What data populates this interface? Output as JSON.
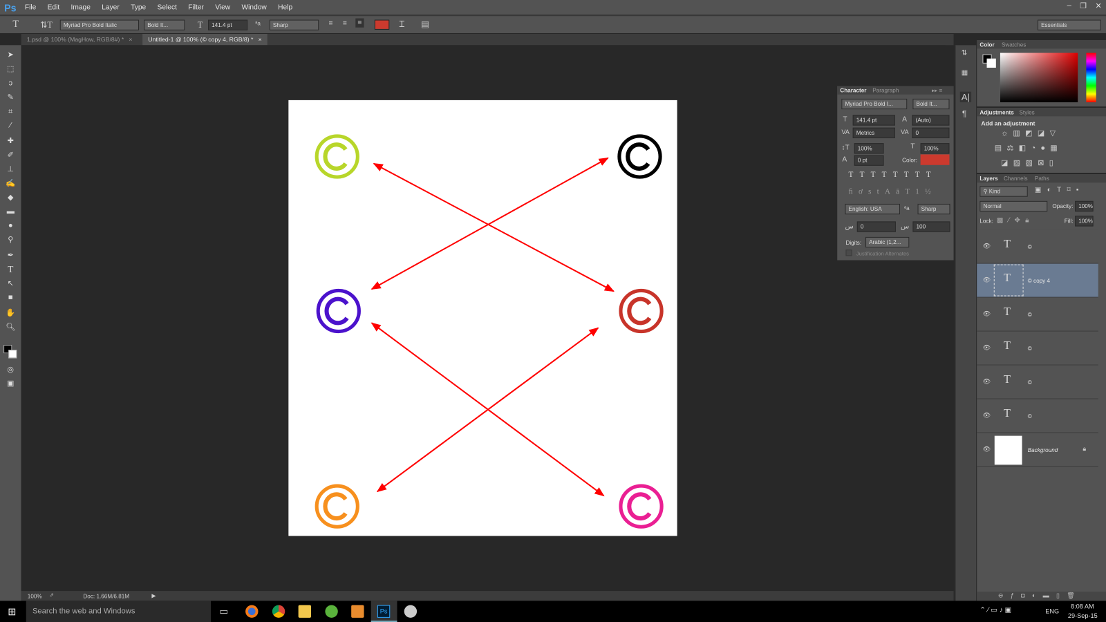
{
  "app": {
    "logo": "Ps"
  },
  "menu": [
    "File",
    "Edit",
    "Image",
    "Layer",
    "Type",
    "Select",
    "Filter",
    "View",
    "Window",
    "Help"
  ],
  "window_buttons": [
    "minimize",
    "restore",
    "close"
  ],
  "options": {
    "font_family": "Myriad Pro Bold Italic",
    "font_style": "Bold It...",
    "font_size": "141.4 pt",
    "antialias": "Sharp",
    "text_color": "#cc3a2e",
    "workspace": "Essentials"
  },
  "tabs": [
    {
      "label": "1.psd @ 100% (MagHow, RGB/8#) *",
      "active": false
    },
    {
      "label": "Untitled-1 @ 100% (© copy 4, RGB/8) *",
      "active": true
    }
  ],
  "canvas": {
    "symbol": "©",
    "symbols": [
      {
        "color": "#b8d62a"
      },
      {
        "color": "#000000"
      },
      {
        "color": "#4b12cc"
      },
      {
        "color": "#c8342a"
      },
      {
        "color": "#f7901e"
      },
      {
        "color": "#ea1f93"
      }
    ],
    "arrow_color": "#ff0000"
  },
  "status": {
    "zoom": "100%",
    "doc": "Doc: 1.66M/6.81M"
  },
  "color_panel": {
    "tabs": [
      "Color",
      "Swatches"
    ]
  },
  "adjustments": {
    "tabs": [
      "Adjustments",
      "Styles"
    ],
    "title": "Add an adjustment"
  },
  "character": {
    "tabs": [
      "Character",
      "Paragraph"
    ],
    "font_family": "Myriad Pro Bold I...",
    "font_style": "Bold It...",
    "size": "141.4 pt",
    "leading": "(Auto)",
    "kerning": "Metrics",
    "tracking": "0",
    "vscale": "100%",
    "hscale": "100%",
    "baseline": "0 pt",
    "color_label": "Color:",
    "color": "#cc3a2e",
    "language": "English: USA",
    "antialias": "Sharp",
    "kashida1": "0",
    "kashida2": "100",
    "digits_label": "Digits:",
    "digits": "Arabic (1,2...",
    "justification": "Justification Alternates"
  },
  "layers": {
    "tabs": [
      "Layers",
      "Channels",
      "Paths"
    ],
    "filter": "Kind",
    "blend": "Normal",
    "opacity_label": "Opacity:",
    "opacity": "100%",
    "lock_label": "Lock:",
    "fill_label": "Fill:",
    "fill": "100%",
    "items": [
      {
        "name": "©",
        "type": "text",
        "selected": false
      },
      {
        "name": "© copy 4",
        "type": "text",
        "selected": true
      },
      {
        "name": "©",
        "type": "text",
        "selected": false
      },
      {
        "name": "©",
        "type": "text",
        "selected": false
      },
      {
        "name": "©",
        "type": "text",
        "selected": false
      },
      {
        "name": "©",
        "type": "text",
        "selected": false
      },
      {
        "name": "Background",
        "type": "image",
        "selected": false,
        "locked": true
      }
    ]
  },
  "taskbar": {
    "search_placeholder": "Search the web and Windows",
    "language": "ENG",
    "time": "8:08 AM",
    "date": "29-Sep-15"
  }
}
